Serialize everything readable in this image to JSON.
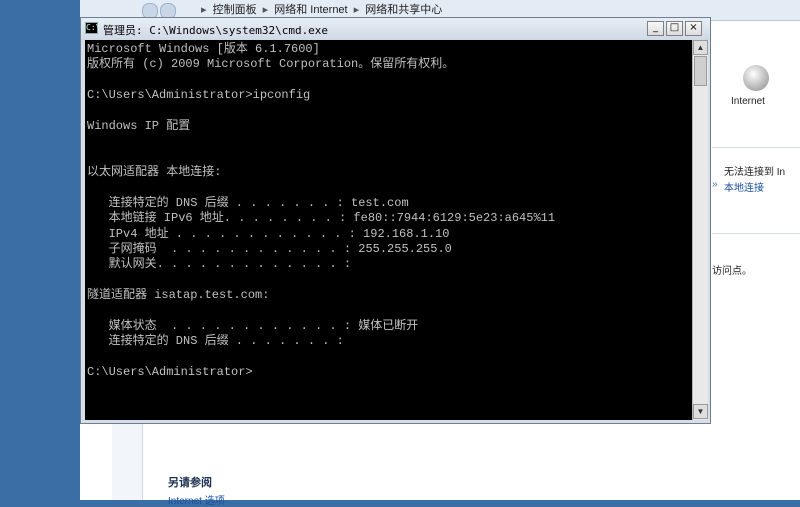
{
  "control_panel": {
    "breadcrumb": [
      "控制面板",
      "网络和 Internet",
      "网络和共享中心"
    ],
    "internet_label": "Internet",
    "no_connect_text": "无法连接到 In",
    "local_connection_link": "本地连接",
    "access_point_text": "访问点。",
    "see_also_heading": "另请参阅",
    "internet_options_link": "Internet 选项"
  },
  "cmd_window": {
    "title": "管理员: C:\\Windows\\system32\\cmd.exe",
    "icon_text": "C:\\",
    "minimize_label": "_",
    "maximize_label": "□",
    "close_label": "×",
    "scroll_up": "▲",
    "scroll_down": "▼",
    "lines": [
      "Microsoft Windows [版本 6.1.7600]",
      "版权所有 (c) 2009 Microsoft Corporation。保留所有权利。",
      "",
      "C:\\Users\\Administrator>ipconfig",
      "",
      "Windows IP 配置",
      "",
      "",
      "以太网适配器 本地连接:",
      "",
      "   连接特定的 DNS 后缀 . . . . . . . : test.com",
      "   本地链接 IPv6 地址. . . . . . . . : fe80::7944:6129:5e23:a645%11",
      "   IPv4 地址 . . . . . . . . . . . . : 192.168.1.10",
      "   子网掩码  . . . . . . . . . . . . : 255.255.255.0",
      "   默认网关. . . . . . . . . . . . . :",
      "",
      "隧道适配器 isatap.test.com:",
      "",
      "   媒体状态  . . . . . . . . . . . . : 媒体已断开",
      "   连接特定的 DNS 后缀 . . . . . . . :",
      "",
      "C:\\Users\\Administrator>"
    ]
  }
}
